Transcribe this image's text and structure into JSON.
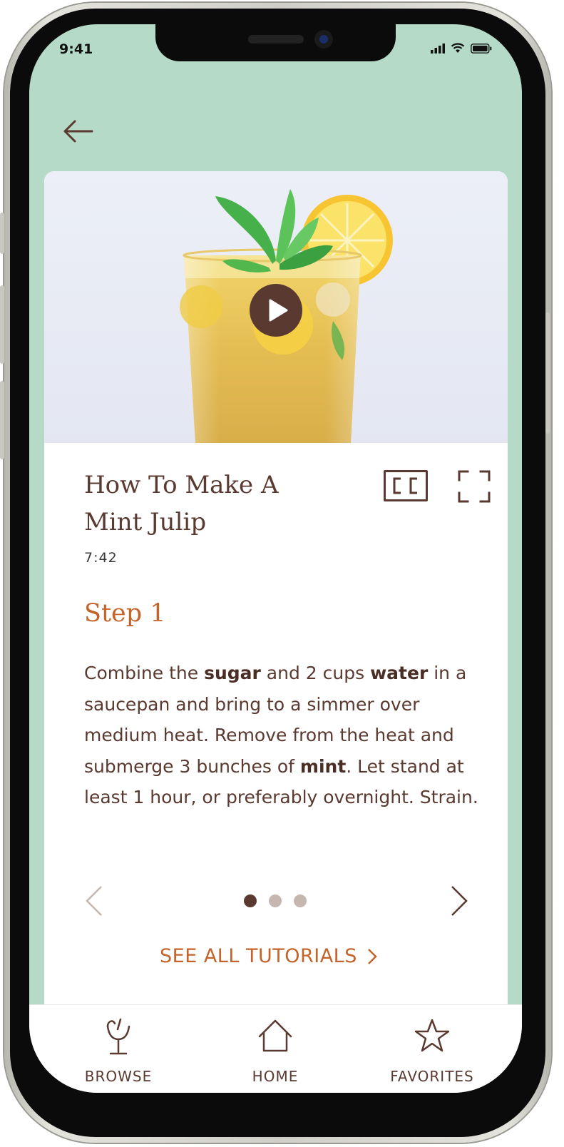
{
  "status_bar": {
    "time": "9:41"
  },
  "nav": {
    "back_icon": "arrow-left-icon"
  },
  "video": {
    "title": "How To Make A Mint Julip",
    "duration": "7:42",
    "play_icon": "play-icon",
    "cc_icon": "closed-captions-icon",
    "fullscreen_icon": "fullscreen-icon"
  },
  "step": {
    "title": "Step 1",
    "text_parts": [
      "Combine the ",
      "sugar",
      " and 2 cups ",
      "water",
      " in a saucepan and bring to a simmer over medium heat. Remove from the heat and submerge 3 bunches of ",
      "mint",
      ". Let stand at least 1 hour, or preferably overnight. Strain."
    ],
    "current_page": 1,
    "total_pages": 3
  },
  "see_all": {
    "label": "SEE ALL TUTORIALS"
  },
  "tabbar": {
    "items": [
      {
        "label": "BROWSE",
        "icon": "cocktail-glass-icon"
      },
      {
        "label": "HOME",
        "icon": "house-icon"
      },
      {
        "label": "FAVORITES",
        "icon": "star-icon"
      }
    ]
  },
  "colors": {
    "background": "#b5dac8",
    "primary_brown": "#5a3a30",
    "accent_orange": "#c4632a",
    "dot_inactive": "#c6b6b0"
  }
}
